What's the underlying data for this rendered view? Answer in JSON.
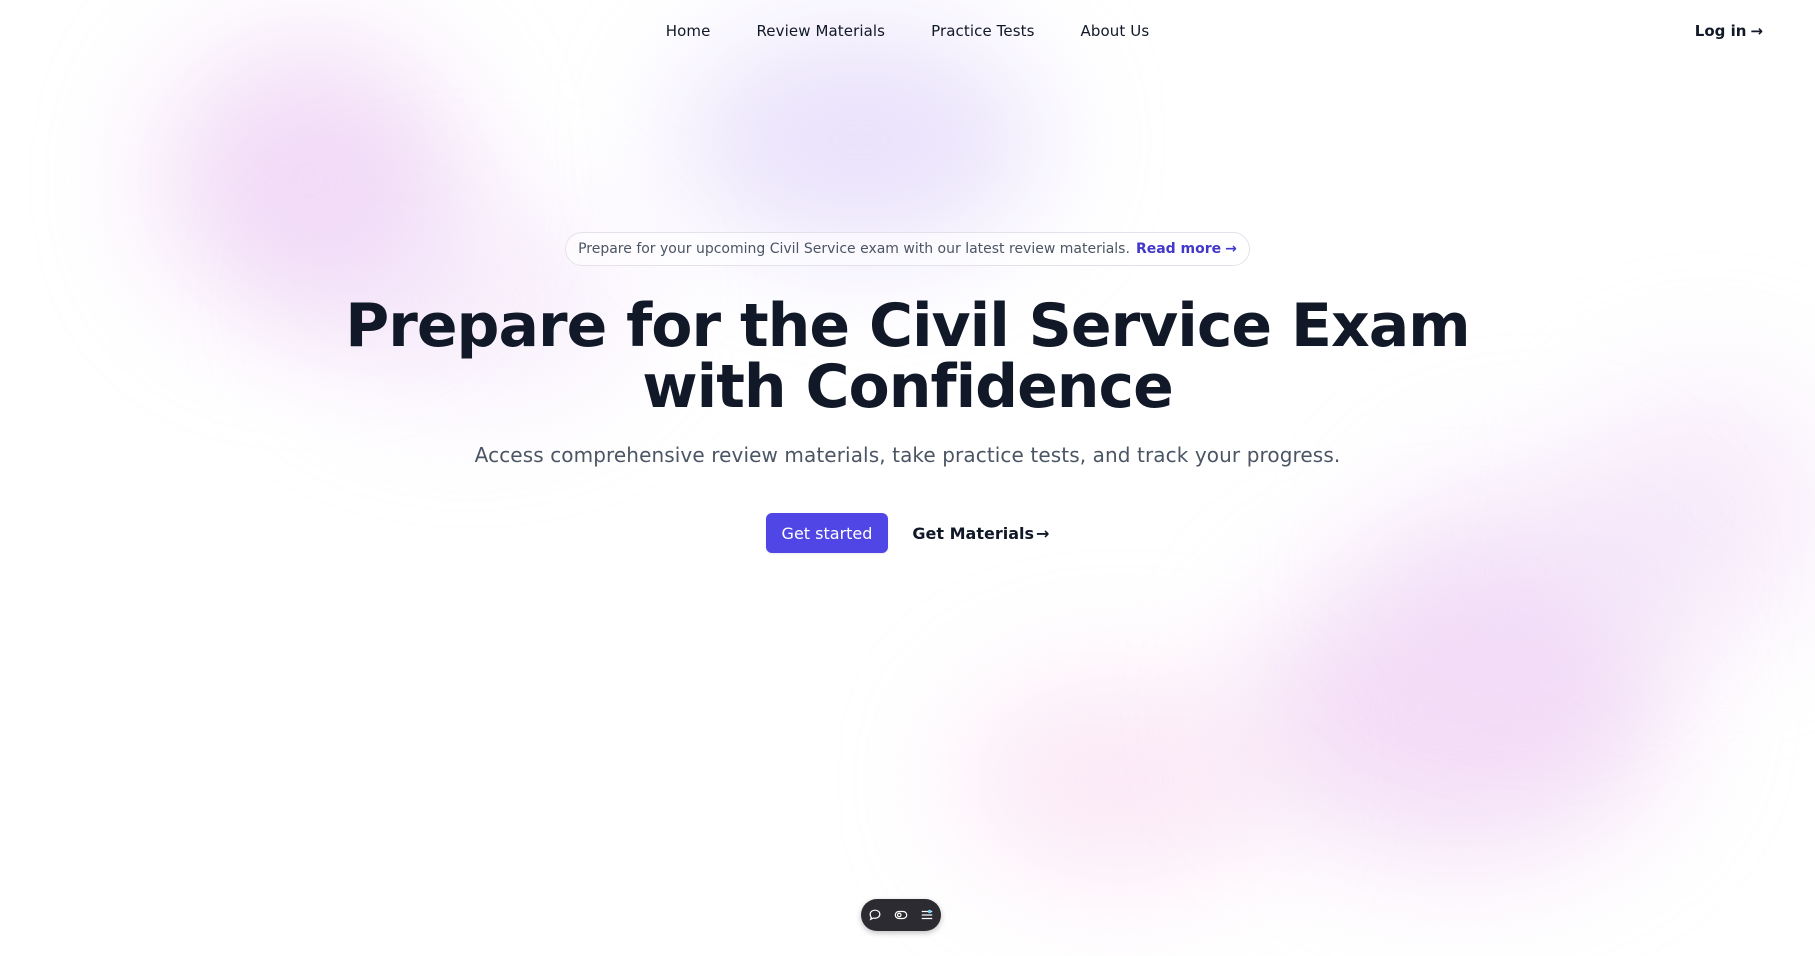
{
  "nav": {
    "items": [
      {
        "label": "Home"
      },
      {
        "label": "Review Materials"
      },
      {
        "label": "Practice Tests"
      },
      {
        "label": "About Us"
      }
    ],
    "login_label": "Log in",
    "login_arrow": "→"
  },
  "announcement": {
    "text": "Prepare for your upcoming Civil Service exam with our latest review materials.",
    "link_label": "Read more",
    "link_arrow": "→"
  },
  "hero": {
    "title_line1": "Prepare for the Civil Service Exam",
    "title_line2": "with Confidence",
    "subtitle": "Access comprehensive review materials, take practice tests, and track your progress.",
    "primary_button": "Get started",
    "secondary_link": "Get Materials",
    "secondary_arrow": "→"
  },
  "toolbar": {
    "icons": [
      "chat-icon",
      "toggle-icon",
      "settings-sliders-icon"
    ]
  },
  "colors": {
    "accent": "#4f46e5",
    "link": "#4338ca",
    "text": "#111827",
    "muted": "#4b5563",
    "toolbar_bg": "#2b2b31"
  }
}
